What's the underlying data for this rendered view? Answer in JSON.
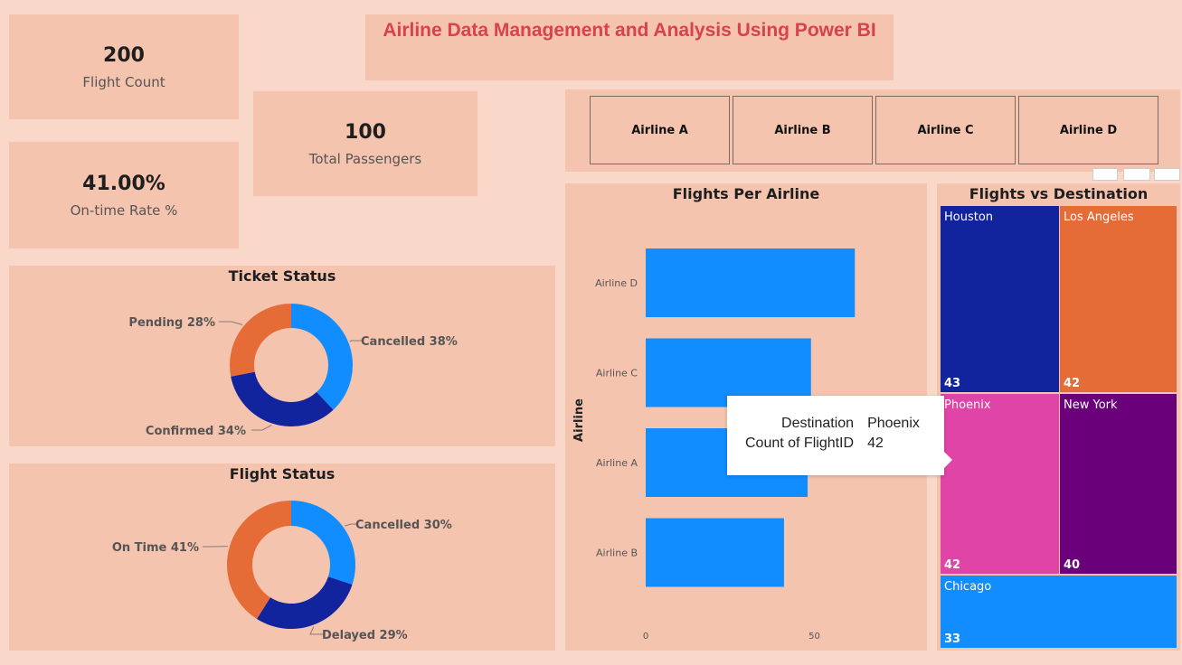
{
  "title": "Airline Data Management and Analysis Using Power BI",
  "kpis": {
    "flight_count": {
      "value": "200",
      "label": "Flight Count"
    },
    "total_passengers": {
      "value": "100",
      "label": "Total Passengers"
    },
    "on_time_rate": {
      "value": "41.00%",
      "label": "On-time Rate %"
    }
  },
  "slicer": {
    "items": [
      "Airline A",
      "Airline B",
      "Airline C",
      "Airline D"
    ]
  },
  "tooltip": {
    "rows": [
      {
        "key": "Destination",
        "value": "Phoenix"
      },
      {
        "key": "Count of FlightID",
        "value": "42"
      }
    ]
  },
  "colors": {
    "blue": "#118dff",
    "navy": "#12239e",
    "orange": "#e66c37",
    "pink": "#e044a7",
    "purple": "#6b007b",
    "title_red": "#d9414e",
    "card_bg": "#f4c4ae",
    "page_bg": "#f9d8ca"
  },
  "chart_data": [
    {
      "type": "pie",
      "title": "Ticket Status",
      "slices": [
        {
          "name": "Cancelled",
          "value": 38,
          "label": "Cancelled 38%",
          "color": "#118dff"
        },
        {
          "name": "Confirmed",
          "value": 34,
          "label": "Confirmed 34%",
          "color": "#12239e"
        },
        {
          "name": "Pending",
          "value": 28,
          "label": "Pending 28%",
          "color": "#e66c37"
        }
      ]
    },
    {
      "type": "pie",
      "title": "Flight Status",
      "slices": [
        {
          "name": "Cancelled",
          "value": 30,
          "label": "Cancelled 30%",
          "color": "#118dff"
        },
        {
          "name": "Delayed",
          "value": 29,
          "label": "Delayed 29%",
          "color": "#12239e"
        },
        {
          "name": "On Time",
          "value": 41,
          "label": "On Time 41%",
          "color": "#e66c37"
        }
      ]
    },
    {
      "type": "bar",
      "orientation": "horizontal",
      "title": "Flights Per Airline",
      "categories": [
        "Airline D",
        "Airline C",
        "Airline A",
        "Airline B"
      ],
      "values": [
        62,
        49,
        48,
        41
      ],
      "ylabel": "Airline",
      "xlabel": "",
      "xticks": [
        "0",
        "50"
      ],
      "xlim": [
        0,
        74
      ],
      "color": "#118dff"
    },
    {
      "type": "treemap",
      "title": "Flights vs Destination",
      "items": [
        {
          "name": "Houston",
          "value": 43,
          "color": "#12239e"
        },
        {
          "name": "Los Angeles",
          "value": 42,
          "color": "#e66c37"
        },
        {
          "name": "Phoenix",
          "value": 42,
          "color": "#e044a7"
        },
        {
          "name": "New York",
          "value": 40,
          "color": "#6b007b"
        },
        {
          "name": "Chicago",
          "value": 33,
          "color": "#118dff"
        }
      ]
    }
  ]
}
